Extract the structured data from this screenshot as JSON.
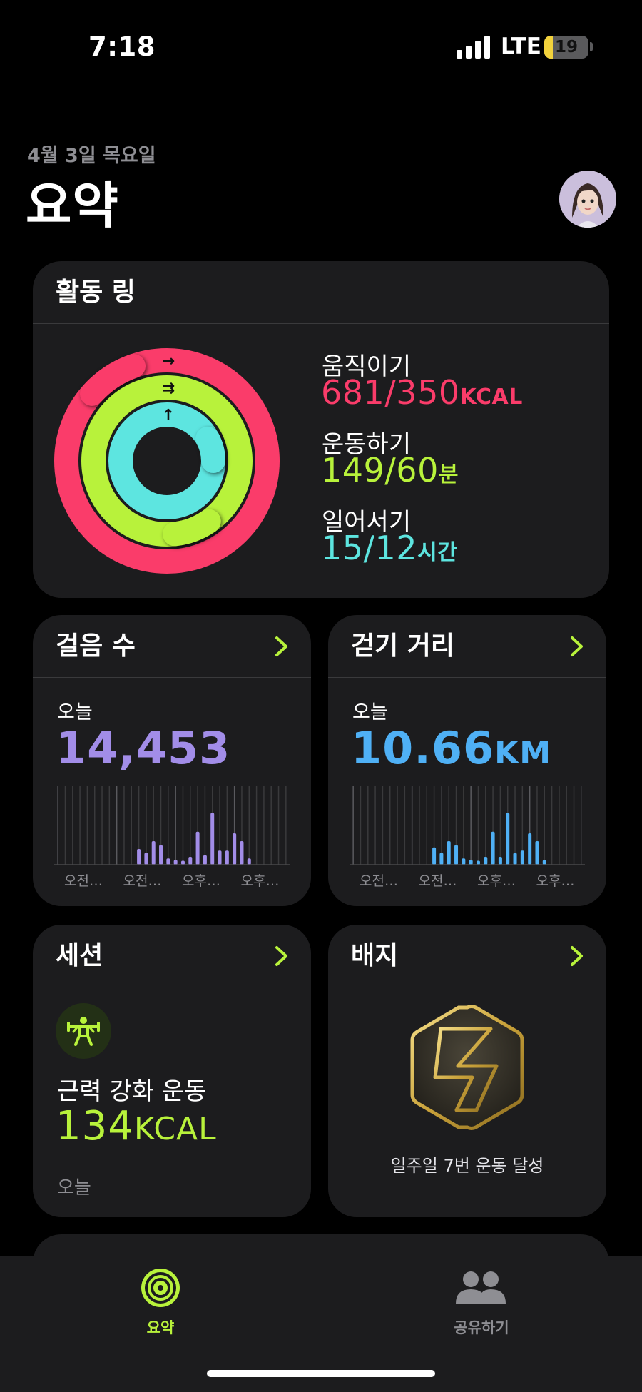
{
  "status_bar": {
    "time": "7:18",
    "network": "LTE",
    "battery": "19",
    "battery_level": 0.19
  },
  "header": {
    "date": "4월 3일 목요일",
    "title": "요약",
    "avatar_icon": "memoji-avatar"
  },
  "activity_rings": {
    "title": "활동 링",
    "move": {
      "label": "움직이기",
      "value": "681/350",
      "unit": "KCAL",
      "color": "#fa3c6a",
      "progress": 1.946
    },
    "exercise": {
      "label": "운동하기",
      "value": "149/60",
      "unit": "분",
      "color": "#b8f23b",
      "progress": 2.483
    },
    "stand": {
      "label": "일어서기",
      "value": "15/12",
      "unit": "시간",
      "color": "#5de5e0",
      "progress": 1.25
    }
  },
  "steps": {
    "title": "걸음 수",
    "period": "오늘",
    "value": "14,453",
    "color": "#a28de8",
    "bars": [
      0,
      0,
      0,
      0,
      0,
      0,
      0,
      0,
      0,
      0,
      0,
      0.2,
      0.15,
      0.3,
      0.25,
      0.08,
      0.06,
      0.05,
      0.1,
      0.42,
      0.12,
      0.66,
      0.18,
      0.18,
      0.4,
      0.3,
      0.08,
      0,
      0,
      0,
      0,
      0
    ],
    "time_labels": [
      "오전…",
      "오전…",
      "오후…",
      "오후…"
    ]
  },
  "distance": {
    "title": "걷기 거리",
    "period": "오늘",
    "value": "10.66",
    "unit": "KM",
    "color": "#4fb0f5",
    "bars": [
      0,
      0,
      0,
      0,
      0,
      0,
      0,
      0,
      0,
      0,
      0,
      0.22,
      0.15,
      0.3,
      0.25,
      0.08,
      0.06,
      0.05,
      0.1,
      0.42,
      0.1,
      0.66,
      0.15,
      0.18,
      0.4,
      0.3,
      0.06,
      0,
      0,
      0,
      0,
      0
    ],
    "time_labels": [
      "오전…",
      "오전…",
      "오후…",
      "오후…"
    ]
  },
  "session": {
    "title": "세션",
    "icon": "weightlifting-icon",
    "workout": "근력 강화 운동",
    "kcal": "134",
    "unit": "KCAL",
    "when": "오늘"
  },
  "badges": {
    "title": "배지",
    "badge_icon": "gold-hexagon-seven-badge",
    "caption": "일주일 7번 운동 달성"
  },
  "tabs": [
    {
      "label": "요약",
      "icon": "activity-rings-icon",
      "active": true,
      "color": "#b8f23b"
    },
    {
      "label": "공유하기",
      "icon": "people-icon",
      "active": false,
      "color": "#8e8e93"
    }
  ]
}
